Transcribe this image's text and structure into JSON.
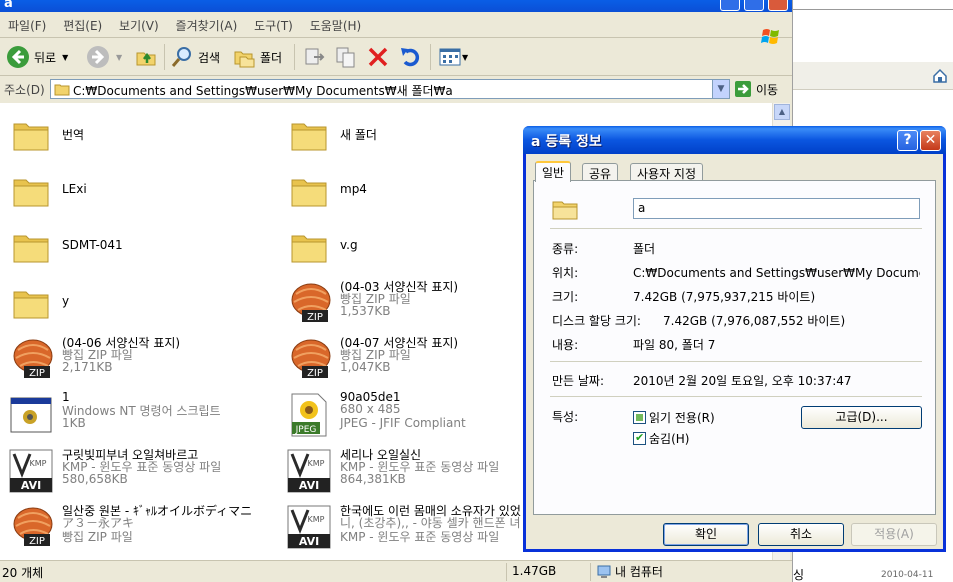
{
  "explorer": {
    "title": "a",
    "menu": [
      "파일(F)",
      "편집(E)",
      "보기(V)",
      "즐겨찾기(A)",
      "도구(T)",
      "도움말(H)"
    ],
    "toolbar": {
      "back": "뒤로",
      "search": "검색",
      "folders": "폴더"
    },
    "address": {
      "label": "주소(D)",
      "path": "C:₩Documents and Settings₩user₩My Documents₩새 폴더₩a",
      "go": "이동"
    },
    "items": [
      {
        "name": "번역",
        "type": "folder"
      },
      {
        "name": "새 폴더",
        "type": "folder"
      },
      {
        "name": "LExi",
        "type": "folder"
      },
      {
        "name": "mp4",
        "type": "folder"
      },
      {
        "name": "SDMT-041",
        "type": "folder"
      },
      {
        "name": "v.g",
        "type": "folder"
      },
      {
        "name": "y",
        "type": "folder"
      },
      {
        "name": "(04-03 서양신작 표지)",
        "type": "zip",
        "line2": "빵집 ZIP 파일",
        "line3": "1,537KB"
      },
      {
        "name": "(04-06 서양신작 표지)",
        "type": "zip",
        "line2": "빵집 ZIP 파일",
        "line3": "2,171KB"
      },
      {
        "name": "(04-07 서양신작 표지)",
        "type": "zip",
        "line2": "빵집 ZIP 파일",
        "line3": "1,047KB"
      },
      {
        "name": "1",
        "type": "cmd",
        "line2": "Windows NT 명령어 스크립트",
        "line3": "1KB"
      },
      {
        "name": "90a05de1",
        "type": "jpeg",
        "line2": "680 x 485",
        "line3": "JPEG - JFIF Compliant"
      },
      {
        "name": "구릿빛피부녀 오일쳐바르고",
        "type": "avi",
        "line2": "KMP - 윈도우 표준 동영상 파일",
        "line3": "580,658KB"
      },
      {
        "name": "세리나 오일실신",
        "type": "avi",
        "line2": "KMP - 윈도우 표준 동영상 파일",
        "line3": "864,381KB"
      },
      {
        "name": "일산중 원본 - ｷﾞｬﾙオイルボディマニ",
        "type": "zip",
        "line2": "ア３－永アキ",
        "line3": "빵집 ZIP 파일"
      },
      {
        "name": "한국에도 이런 몸매의 소유자가 있었",
        "type": "avi",
        "line2": "니, (초강추),, - 야동 셀카 핸드폰 녀",
        "line3": "KMP - 윈도우 표준 동영상 파일"
      }
    ],
    "status": {
      "count": "20 개체",
      "size": "1.47GB",
      "location": "내 컴퓨터"
    }
  },
  "background": {
    "date": "2010-04-11",
    "frag": "싱"
  },
  "dialog": {
    "title": "a 등록 정보",
    "help": "?",
    "close": "✕",
    "tabs": [
      "일반",
      "공유",
      "사용자 지정"
    ],
    "name_value": "a",
    "rows": {
      "type_label": "종류:",
      "type_value": "폴더",
      "loc_label": "위치:",
      "loc_value": "C:₩Documents and Settings₩user₩My Documents₩새 폴더",
      "size_label": "크기:",
      "size_value": "7.42GB (7,975,937,215 바이트)",
      "disk_label": "디스크 할당 크기:",
      "disk_value": "7.42GB (7,976,087,552 바이트)",
      "contents_label": "내용:",
      "contents_value": "파일 80, 폴더 7",
      "created_label": "만든 날짜:",
      "created_value": "2010년 2월 20일 토요일, 오후 10:37:47",
      "attr_label": "특성:"
    },
    "readonly": "읽기 전용(R)",
    "hidden": "숨김(H)",
    "advanced": "고급(D)...",
    "ok": "확인",
    "cancel": "취소",
    "apply": "적용(A)"
  }
}
